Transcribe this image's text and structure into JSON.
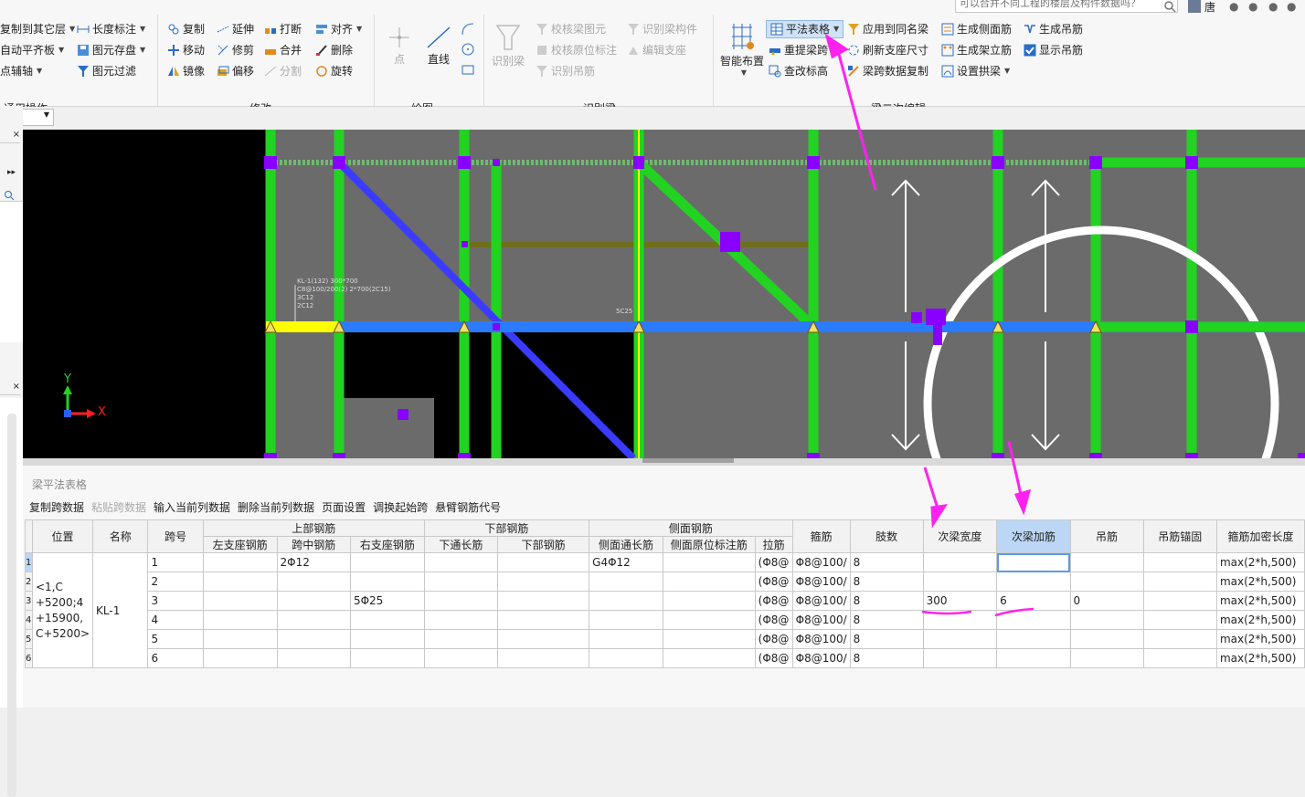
{
  "search": {
    "placeholder": "可以合并不同工程的楼层及构件数据吗？"
  },
  "user": {
    "name": "唐"
  },
  "ribbon": {
    "groups": {
      "common": {
        "label": "通用操作",
        "items": [
          "复制到其它层",
          "自动平齐板",
          "点辅轴",
          "长度标注",
          "图元存盘",
          "图元过滤"
        ]
      },
      "modify": {
        "label": "修改",
        "items": [
          "复制",
          "延伸",
          "打断",
          "对齐",
          "移动",
          "修剪",
          "合并",
          "删除",
          "镜像",
          "偏移",
          "分割",
          "旋转"
        ]
      },
      "draw": {
        "label": "绘图",
        "point": "点",
        "line": "直线"
      },
      "recognize": {
        "label": "识别梁",
        "identify": "识别梁",
        "items": [
          "校核梁图元",
          "识别梁构件",
          "校核原位标注",
          "编辑支座",
          "识别吊筋"
        ]
      },
      "secondary": {
        "label": "梁二次编辑",
        "smart": "智能布置",
        "items": [
          "平法表格",
          "应用到同名梁",
          "生成侧面筋",
          "生成吊筋",
          "重提梁跨",
          "刷新支座尺寸",
          "生成架立筋",
          "显示吊筋",
          "查改标高",
          "梁跨数据复制",
          "设置拱梁"
        ]
      }
    }
  },
  "canvas": {
    "beam_label": [
      "KL-1(132) 300*700",
      "C8@100/200(2)   2*700(2C15)",
      "3C12",
      "2C12"
    ],
    "beam_label2": "5C25",
    "axis_x": "X",
    "axis_y": "Y"
  },
  "table_panel": {
    "title": "梁平法表格",
    "toolbar": [
      "复制跨数据",
      "粘贴跨数据",
      "输入当前列数据",
      "删除当前列数据",
      "页面设置",
      "调换起始跨",
      "悬臂钢筋代号"
    ],
    "header_top": {
      "position": "位置",
      "name": "名称",
      "span": "跨号",
      "upper": "上部钢筋",
      "lower": "下部钢筋",
      "side": "侧面钢筋",
      "stirrup": "箍筋",
      "legs": "肢数",
      "sec_width": "次梁宽度",
      "sec_add": "次梁加筋",
      "hanger": "吊筋",
      "hanger_anchor": "吊筋锚固",
      "dense_len": "箍筋加密长度"
    },
    "header_sub": {
      "left_support": "左支座钢筋",
      "mid": "跨中钢筋",
      "right_support": "右支座钢筋",
      "lower_through": "下通长筋",
      "lower": "下部钢筋",
      "side_through": "侧面通长筋",
      "side_orig": "侧面原位标注筋",
      "tie": "拉筋"
    },
    "position_value": "<1,C\n+5200;4\n+15900,\nC+5200>",
    "name_value": "KL-1",
    "rows": [
      {
        "num": "1",
        "span": "1",
        "mid": "2Φ12",
        "right": "",
        "side_through": "G4Φ12",
        "tie": "(Φ8@",
        "stirrup": "Φ8@100/",
        "legs": "8",
        "sec_width": "",
        "sec_add": "",
        "hanger": "",
        "dense": "max(2*h,500)"
      },
      {
        "num": "2",
        "span": "2",
        "mid": "",
        "right": "",
        "side_through": "",
        "tie": "(Φ8@",
        "stirrup": "Φ8@100/",
        "legs": "8",
        "sec_width": "",
        "sec_add": "",
        "hanger": "",
        "dense": "max(2*h,500)"
      },
      {
        "num": "3",
        "span": "3",
        "mid": "",
        "right": "5Φ25",
        "side_through": "",
        "tie": "(Φ8@",
        "stirrup": "Φ8@100/",
        "legs": "8",
        "sec_width": "300",
        "sec_add": "6",
        "hanger": "0",
        "dense": "max(2*h,500)"
      },
      {
        "num": "4",
        "span": "4",
        "mid": "",
        "right": "",
        "side_through": "",
        "tie": "(Φ8@",
        "stirrup": "Φ8@100/",
        "legs": "8",
        "sec_width": "",
        "sec_add": "",
        "hanger": "",
        "dense": "max(2*h,500)"
      },
      {
        "num": "5",
        "span": "5",
        "mid": "",
        "right": "",
        "side_through": "",
        "tie": "(Φ8@",
        "stirrup": "Φ8@100/",
        "legs": "8",
        "sec_width": "",
        "sec_add": "",
        "hanger": "",
        "dense": "max(2*h,500)"
      },
      {
        "num": "6",
        "span": "6",
        "mid": "",
        "right": "",
        "side_through": "",
        "tie": "(Φ8@",
        "stirrup": "Φ8@100/",
        "legs": "8",
        "sec_width": "",
        "sec_add": "",
        "hanger": "",
        "dense": "max(2*h,500)"
      }
    ]
  },
  "colors": {
    "beam_green": "#22d322",
    "beam_blue": "#2b7bff",
    "beam_diag": "#3b3bff",
    "node": "#8a00ff",
    "annotation": "#ff22ee",
    "selected_header": "#bcd7f5"
  }
}
